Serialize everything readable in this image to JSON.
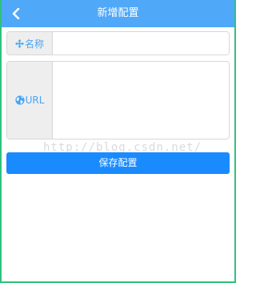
{
  "header": {
    "title": "新增配置",
    "back_icon": "chevron-left-icon"
  },
  "form": {
    "name": {
      "label": "名称",
      "icon": "move-arrows-icon",
      "value": ""
    },
    "url": {
      "label": "URL",
      "icon": "globe-icon",
      "value": ""
    },
    "save_label": "保存配置"
  },
  "watermark": "http://blog.csdn.net/",
  "colors": {
    "header_bg": "#4fa8f8",
    "button_bg": "#1a8bff",
    "label_color": "#4aa3f0",
    "frame_border": "#2ec27e"
  }
}
